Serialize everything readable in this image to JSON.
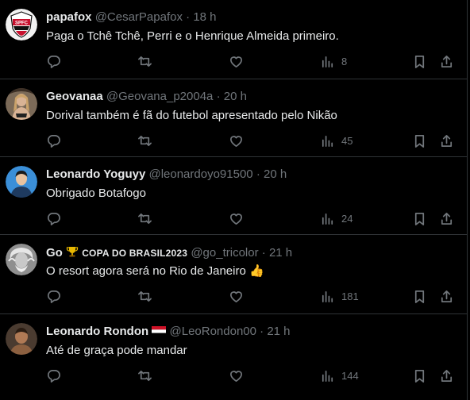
{
  "tweets": [
    {
      "name": "papafox",
      "handle": "@CesarPapafox",
      "sep": "·",
      "time": "18 h",
      "text": "Paga o Tchê Tchê, Perri e o Henrique Almeida primeiro.",
      "views": "8",
      "avatar_text": "SPFC"
    },
    {
      "name": "Geovanaa",
      "handle": "@Geovana_p2004a",
      "sep": "·",
      "time": "20 h",
      "text": "Dorival também é fã do futebol apresentado pelo Nikão",
      "views": "45"
    },
    {
      "name": "Leonardo Yoguyy",
      "handle": "@leonardoyo91500",
      "sep": "·",
      "time": "20 h",
      "text": "Obrigado Botafogo",
      "views": "24"
    },
    {
      "name": "Go",
      "name_badge": "COPA DO BRASIL2023",
      "handle": "@go_tricolor",
      "sep": "·",
      "time": "21 h",
      "text": "O resort agora será no Rio de Janeiro 👍",
      "views": "181"
    },
    {
      "name": "Leonardo Rondon",
      "handle": "@LeoRondon00",
      "sep": "·",
      "time": "21 h",
      "text": "Até de graça pode mandar",
      "views": "144"
    }
  ],
  "icons": {
    "reply": "reply-icon",
    "retweet": "retweet-icon",
    "like": "heart-icon",
    "views": "views-icon",
    "bookmark": "bookmark-icon",
    "share": "share-icon"
  },
  "colors": {
    "background": "#000000",
    "text": "#e7e9ea",
    "muted": "#71767b",
    "border": "#2f3336"
  }
}
